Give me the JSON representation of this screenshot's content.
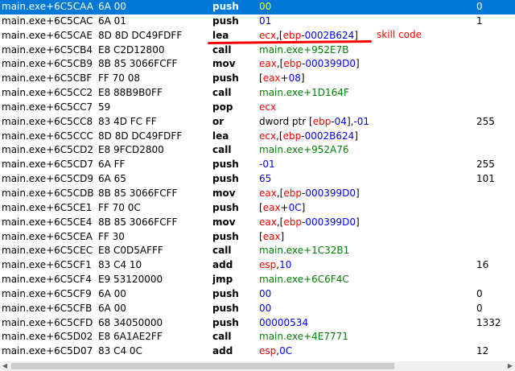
{
  "rows": [
    {
      "addr": "main.exe+6C5CAA",
      "bytes": "6A 00",
      "mn": "push",
      "ops": [
        {
          "t": "00",
          "c": "blue"
        }
      ],
      "comment": "0",
      "selected": true
    },
    {
      "addr": "main.exe+6C5CAC",
      "bytes": "6A 01",
      "mn": "push",
      "ops": [
        {
          "t": "01",
          "c": "blue"
        }
      ],
      "comment": "1"
    },
    {
      "addr": "main.exe+6C5CAE",
      "bytes": "8D 8D DC49FDFF",
      "mn": "lea",
      "ops": [
        {
          "t": "ecx",
          "c": "red"
        },
        {
          "t": ",[",
          "c": "black"
        },
        {
          "t": "ebp",
          "c": "red"
        },
        {
          "t": "-",
          "c": "black"
        },
        {
          "t": "0002B624",
          "c": "blue"
        },
        {
          "t": "]",
          "c": "black"
        }
      ],
      "comment": ""
    },
    {
      "addr": "main.exe+6C5CB4",
      "bytes": "E8 C2D12800",
      "mn": "call",
      "ops": [
        {
          "t": "main.exe+952E7B",
          "c": "green"
        }
      ],
      "comment": ""
    },
    {
      "addr": "main.exe+6C5CB9",
      "bytes": "8B 85 3066FCFF",
      "mn": "mov",
      "ops": [
        {
          "t": "eax",
          "c": "red"
        },
        {
          "t": ",[",
          "c": "black"
        },
        {
          "t": "ebp",
          "c": "red"
        },
        {
          "t": "-",
          "c": "black"
        },
        {
          "t": "000399D0",
          "c": "blue"
        },
        {
          "t": "]",
          "c": "black"
        }
      ],
      "comment": ""
    },
    {
      "addr": "main.exe+6C5CBF",
      "bytes": "FF 70 08",
      "mn": "push",
      "ops": [
        {
          "t": "[",
          "c": "black"
        },
        {
          "t": "eax",
          "c": "red"
        },
        {
          "t": "+",
          "c": "black"
        },
        {
          "t": "08",
          "c": "blue"
        },
        {
          "t": "]",
          "c": "black"
        }
      ],
      "comment": ""
    },
    {
      "addr": "main.exe+6C5CC2",
      "bytes": "E8 88B9B0FF",
      "mn": "call",
      "ops": [
        {
          "t": "main.exe+1D164F",
          "c": "green"
        }
      ],
      "comment": ""
    },
    {
      "addr": "main.exe+6C5CC7",
      "bytes": "59",
      "mn": "pop",
      "ops": [
        {
          "t": "ecx",
          "c": "red"
        }
      ],
      "comment": ""
    },
    {
      "addr": "main.exe+6C5CC8",
      "bytes": "83 4D FC FF",
      "mn": "or",
      "ops": [
        {
          "t": "dword ptr [",
          "c": "black"
        },
        {
          "t": "ebp",
          "c": "red"
        },
        {
          "t": "-",
          "c": "black"
        },
        {
          "t": "04",
          "c": "blue"
        },
        {
          "t": "],",
          "c": "black"
        },
        {
          "t": "-01",
          "c": "blue"
        }
      ],
      "comment": "255"
    },
    {
      "addr": "main.exe+6C5CCC",
      "bytes": "8D 8D DC49FDFF",
      "mn": "lea",
      "ops": [
        {
          "t": "ecx",
          "c": "red"
        },
        {
          "t": ",[",
          "c": "black"
        },
        {
          "t": "ebp",
          "c": "red"
        },
        {
          "t": "-",
          "c": "black"
        },
        {
          "t": "0002B624",
          "c": "blue"
        },
        {
          "t": "]",
          "c": "black"
        }
      ],
      "comment": ""
    },
    {
      "addr": "main.exe+6C5CD2",
      "bytes": "E8 9FCD2800",
      "mn": "call",
      "ops": [
        {
          "t": "main.exe+952A76",
          "c": "green"
        }
      ],
      "comment": ""
    },
    {
      "addr": "main.exe+6C5CD7",
      "bytes": "6A FF",
      "mn": "push",
      "ops": [
        {
          "t": "-01",
          "c": "blue"
        }
      ],
      "comment": "255"
    },
    {
      "addr": "main.exe+6C5CD9",
      "bytes": "6A 65",
      "mn": "push",
      "ops": [
        {
          "t": "65",
          "c": "blue"
        }
      ],
      "comment": "101"
    },
    {
      "addr": "main.exe+6C5CDB",
      "bytes": "8B 85 3066FCFF",
      "mn": "mov",
      "ops": [
        {
          "t": "eax",
          "c": "red"
        },
        {
          "t": ",[",
          "c": "black"
        },
        {
          "t": "ebp",
          "c": "red"
        },
        {
          "t": "-",
          "c": "black"
        },
        {
          "t": "000399D0",
          "c": "blue"
        },
        {
          "t": "]",
          "c": "black"
        }
      ],
      "comment": ""
    },
    {
      "addr": "main.exe+6C5CE1",
      "bytes": "FF 70 0C",
      "mn": "push",
      "ops": [
        {
          "t": "[",
          "c": "black"
        },
        {
          "t": "eax",
          "c": "red"
        },
        {
          "t": "+",
          "c": "black"
        },
        {
          "t": "0C",
          "c": "blue"
        },
        {
          "t": "]",
          "c": "black"
        }
      ],
      "comment": ""
    },
    {
      "addr": "main.exe+6C5CE4",
      "bytes": "8B 85 3066FCFF",
      "mn": "mov",
      "ops": [
        {
          "t": "eax",
          "c": "red"
        },
        {
          "t": ",[",
          "c": "black"
        },
        {
          "t": "ebp",
          "c": "red"
        },
        {
          "t": "-",
          "c": "black"
        },
        {
          "t": "000399D0",
          "c": "blue"
        },
        {
          "t": "]",
          "c": "black"
        }
      ],
      "comment": ""
    },
    {
      "addr": "main.exe+6C5CEA",
      "bytes": "FF 30",
      "mn": "push",
      "ops": [
        {
          "t": "[",
          "c": "black"
        },
        {
          "t": "eax",
          "c": "red"
        },
        {
          "t": "]",
          "c": "black"
        }
      ],
      "comment": ""
    },
    {
      "addr": "main.exe+6C5CEC",
      "bytes": "E8 C0D5AFFF",
      "mn": "call",
      "ops": [
        {
          "t": "main.exe+1C32B1",
          "c": "green"
        }
      ],
      "comment": ""
    },
    {
      "addr": "main.exe+6C5CF1",
      "bytes": "83 C4 10",
      "mn": "add",
      "ops": [
        {
          "t": "esp",
          "c": "red"
        },
        {
          "t": ",",
          "c": "black"
        },
        {
          "t": "10",
          "c": "blue"
        }
      ],
      "comment": "16"
    },
    {
      "addr": "main.exe+6C5CF4",
      "bytes": "E9 53120000",
      "mn": "jmp",
      "ops": [
        {
          "t": "main.exe+6C6F4C",
          "c": "green"
        }
      ],
      "comment": ""
    },
    {
      "addr": "main.exe+6C5CF9",
      "bytes": "6A 00",
      "mn": "push",
      "ops": [
        {
          "t": "00",
          "c": "blue"
        }
      ],
      "comment": "0"
    },
    {
      "addr": "main.exe+6C5CFB",
      "bytes": "6A 00",
      "mn": "push",
      "ops": [
        {
          "t": "00",
          "c": "blue"
        }
      ],
      "comment": "0"
    },
    {
      "addr": "main.exe+6C5CFD",
      "bytes": "68 34050000",
      "mn": "push",
      "ops": [
        {
          "t": "00000534",
          "c": "blue"
        }
      ],
      "comment": "1332"
    },
    {
      "addr": "main.exe+6C5D02",
      "bytes": "E8 6A1AE2FF",
      "mn": "call",
      "ops": [
        {
          "t": "main.exe+4E7771",
          "c": "green"
        }
      ],
      "comment": ""
    },
    {
      "addr": "main.exe+6C5D07",
      "bytes": "83 C4 0C",
      "mn": "add",
      "ops": [
        {
          "t": "esp",
          "c": "red"
        },
        {
          "t": ",",
          "c": "black"
        },
        {
          "t": "0C",
          "c": "blue"
        }
      ],
      "comment": "12"
    }
  ],
  "annotation": {
    "text": "skill code",
    "color": "#ff0000"
  },
  "colors": {
    "selection": "#0078d7",
    "register": "#ff0000",
    "immediate": "#0000ff",
    "address": "#008000"
  },
  "scrollbar": {
    "left_icon": "triangle-left-icon",
    "right_icon": "triangle-right-icon"
  }
}
